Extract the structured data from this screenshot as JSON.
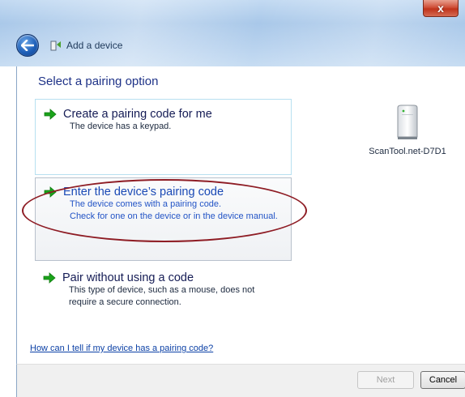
{
  "window": {
    "title": "Add a device",
    "close_label": "x"
  },
  "page": {
    "heading": "Select a pairing option"
  },
  "options": [
    {
      "title": "Create a pairing code for me",
      "description": [
        "The device has a keypad."
      ]
    },
    {
      "title": "Enter the device’s pairing code",
      "description": [
        "The device comes with a pairing code.",
        "Check for one on the device or in the device manual."
      ]
    },
    {
      "title": "Pair without using a code",
      "description": [
        "This type of device, such as a mouse, does not",
        "require a secure connection."
      ]
    }
  ],
  "device": {
    "icon": "tower-device-icon",
    "name": "ScanTool.net-D7D1"
  },
  "help_link": "How can I tell if my device has a pairing code?",
  "footer": {
    "next_label": "Next",
    "cancel_label": "Cancel"
  },
  "colors": {
    "accent_link": "#1a49b5",
    "annotation_ellipse": "#8e1c24",
    "arrow_green": "#1aa31a"
  }
}
